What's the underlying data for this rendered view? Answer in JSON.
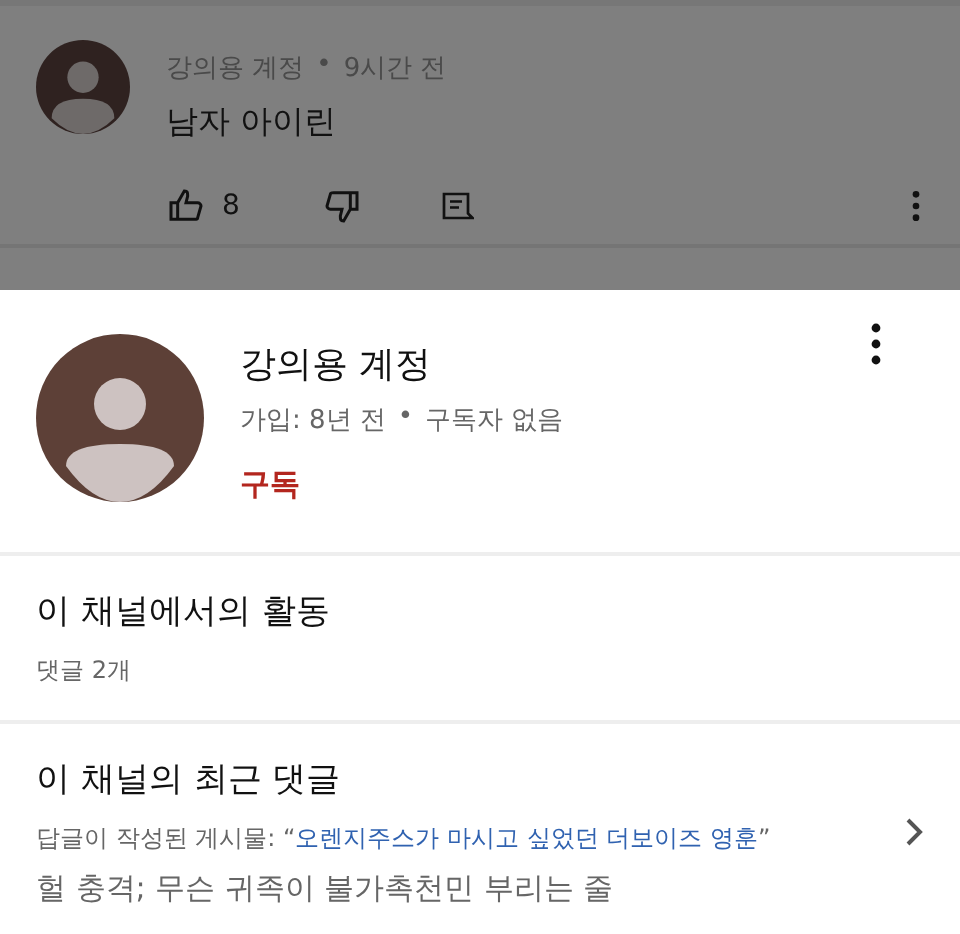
{
  "background_comment": {
    "author": "강의용 계정",
    "separator": "•",
    "time": "9시간 전",
    "text": "남자 아이린",
    "likes": "8"
  },
  "channel": {
    "name": "강의용 계정",
    "meta_joined": "가입: 8년 전",
    "separator": "•",
    "meta_subs": "구독자 없음",
    "subscribe": "구독"
  },
  "activity": {
    "title": "이 채널에서의 활동",
    "count": "댓글 2개"
  },
  "recent": {
    "title": "이 채널의 최근 댓글",
    "post_prefix": "답글이 작성된 게시물:",
    "quote_open": "“",
    "post_title": "오렌지주스가 마시고 싶었던 더보이즈 영훈",
    "quote_close": "”",
    "comment": "헐 충격; 무슨 귀족이 불가촉천민 부리는 줄"
  }
}
